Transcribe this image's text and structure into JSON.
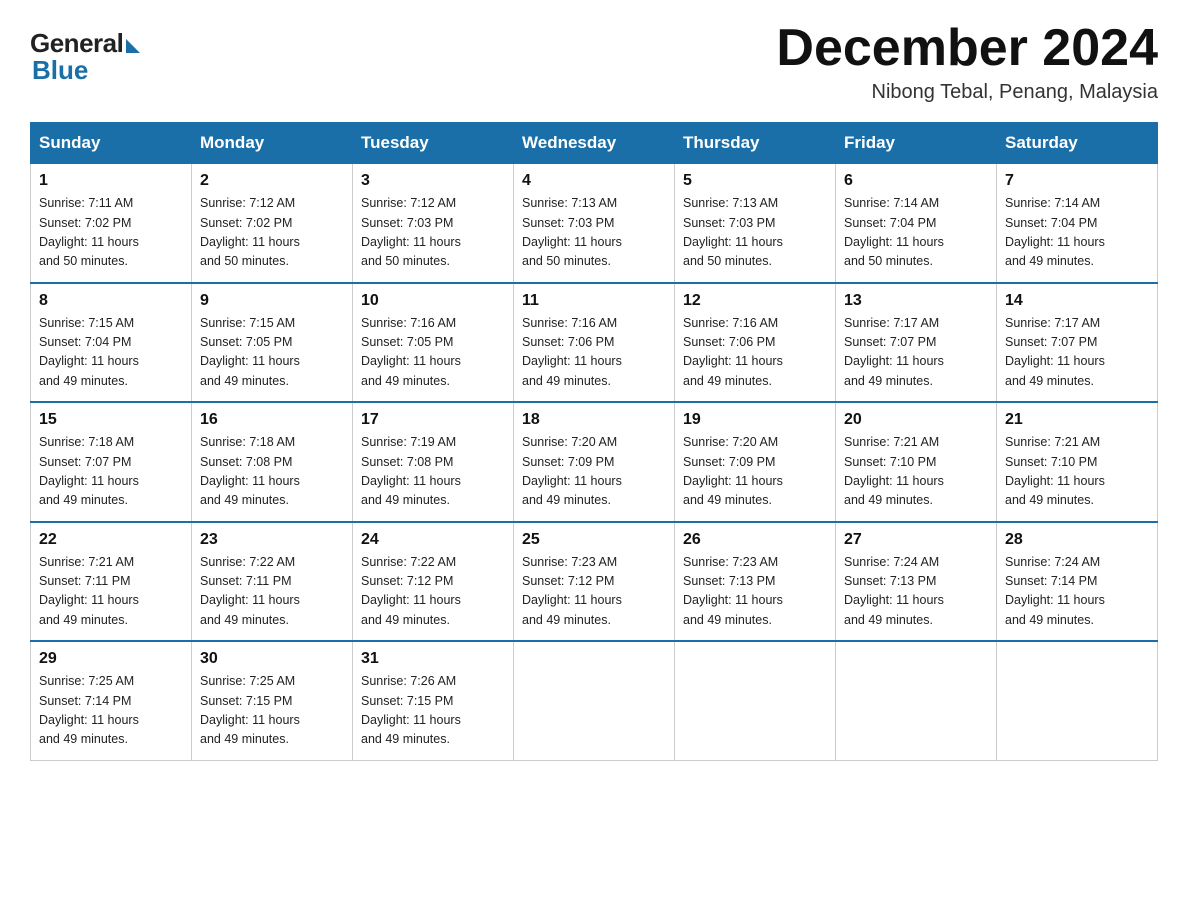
{
  "header": {
    "logo_general": "General",
    "logo_blue": "Blue",
    "month_title": "December 2024",
    "location": "Nibong Tebal, Penang, Malaysia"
  },
  "days_of_week": [
    "Sunday",
    "Monday",
    "Tuesday",
    "Wednesday",
    "Thursday",
    "Friday",
    "Saturday"
  ],
  "weeks": [
    [
      {
        "day": "1",
        "sunrise": "7:11 AM",
        "sunset": "7:02 PM",
        "daylight": "11 hours and 50 minutes."
      },
      {
        "day": "2",
        "sunrise": "7:12 AM",
        "sunset": "7:02 PM",
        "daylight": "11 hours and 50 minutes."
      },
      {
        "day": "3",
        "sunrise": "7:12 AM",
        "sunset": "7:03 PM",
        "daylight": "11 hours and 50 minutes."
      },
      {
        "day": "4",
        "sunrise": "7:13 AM",
        "sunset": "7:03 PM",
        "daylight": "11 hours and 50 minutes."
      },
      {
        "day": "5",
        "sunrise": "7:13 AM",
        "sunset": "7:03 PM",
        "daylight": "11 hours and 50 minutes."
      },
      {
        "day": "6",
        "sunrise": "7:14 AM",
        "sunset": "7:04 PM",
        "daylight": "11 hours and 50 minutes."
      },
      {
        "day": "7",
        "sunrise": "7:14 AM",
        "sunset": "7:04 PM",
        "daylight": "11 hours and 49 minutes."
      }
    ],
    [
      {
        "day": "8",
        "sunrise": "7:15 AM",
        "sunset": "7:04 PM",
        "daylight": "11 hours and 49 minutes."
      },
      {
        "day": "9",
        "sunrise": "7:15 AM",
        "sunset": "7:05 PM",
        "daylight": "11 hours and 49 minutes."
      },
      {
        "day": "10",
        "sunrise": "7:16 AM",
        "sunset": "7:05 PM",
        "daylight": "11 hours and 49 minutes."
      },
      {
        "day": "11",
        "sunrise": "7:16 AM",
        "sunset": "7:06 PM",
        "daylight": "11 hours and 49 minutes."
      },
      {
        "day": "12",
        "sunrise": "7:16 AM",
        "sunset": "7:06 PM",
        "daylight": "11 hours and 49 minutes."
      },
      {
        "day": "13",
        "sunrise": "7:17 AM",
        "sunset": "7:07 PM",
        "daylight": "11 hours and 49 minutes."
      },
      {
        "day": "14",
        "sunrise": "7:17 AM",
        "sunset": "7:07 PM",
        "daylight": "11 hours and 49 minutes."
      }
    ],
    [
      {
        "day": "15",
        "sunrise": "7:18 AM",
        "sunset": "7:07 PM",
        "daylight": "11 hours and 49 minutes."
      },
      {
        "day": "16",
        "sunrise": "7:18 AM",
        "sunset": "7:08 PM",
        "daylight": "11 hours and 49 minutes."
      },
      {
        "day": "17",
        "sunrise": "7:19 AM",
        "sunset": "7:08 PM",
        "daylight": "11 hours and 49 minutes."
      },
      {
        "day": "18",
        "sunrise": "7:20 AM",
        "sunset": "7:09 PM",
        "daylight": "11 hours and 49 minutes."
      },
      {
        "day": "19",
        "sunrise": "7:20 AM",
        "sunset": "7:09 PM",
        "daylight": "11 hours and 49 minutes."
      },
      {
        "day": "20",
        "sunrise": "7:21 AM",
        "sunset": "7:10 PM",
        "daylight": "11 hours and 49 minutes."
      },
      {
        "day": "21",
        "sunrise": "7:21 AM",
        "sunset": "7:10 PM",
        "daylight": "11 hours and 49 minutes."
      }
    ],
    [
      {
        "day": "22",
        "sunrise": "7:21 AM",
        "sunset": "7:11 PM",
        "daylight": "11 hours and 49 minutes."
      },
      {
        "day": "23",
        "sunrise": "7:22 AM",
        "sunset": "7:11 PM",
        "daylight": "11 hours and 49 minutes."
      },
      {
        "day": "24",
        "sunrise": "7:22 AM",
        "sunset": "7:12 PM",
        "daylight": "11 hours and 49 minutes."
      },
      {
        "day": "25",
        "sunrise": "7:23 AM",
        "sunset": "7:12 PM",
        "daylight": "11 hours and 49 minutes."
      },
      {
        "day": "26",
        "sunrise": "7:23 AM",
        "sunset": "7:13 PM",
        "daylight": "11 hours and 49 minutes."
      },
      {
        "day": "27",
        "sunrise": "7:24 AM",
        "sunset": "7:13 PM",
        "daylight": "11 hours and 49 minutes."
      },
      {
        "day": "28",
        "sunrise": "7:24 AM",
        "sunset": "7:14 PM",
        "daylight": "11 hours and 49 minutes."
      }
    ],
    [
      {
        "day": "29",
        "sunrise": "7:25 AM",
        "sunset": "7:14 PM",
        "daylight": "11 hours and 49 minutes."
      },
      {
        "day": "30",
        "sunrise": "7:25 AM",
        "sunset": "7:15 PM",
        "daylight": "11 hours and 49 minutes."
      },
      {
        "day": "31",
        "sunrise": "7:26 AM",
        "sunset": "7:15 PM",
        "daylight": "11 hours and 49 minutes."
      },
      null,
      null,
      null,
      null
    ]
  ],
  "labels": {
    "sunrise": "Sunrise:",
    "sunset": "Sunset:",
    "daylight": "Daylight:"
  }
}
